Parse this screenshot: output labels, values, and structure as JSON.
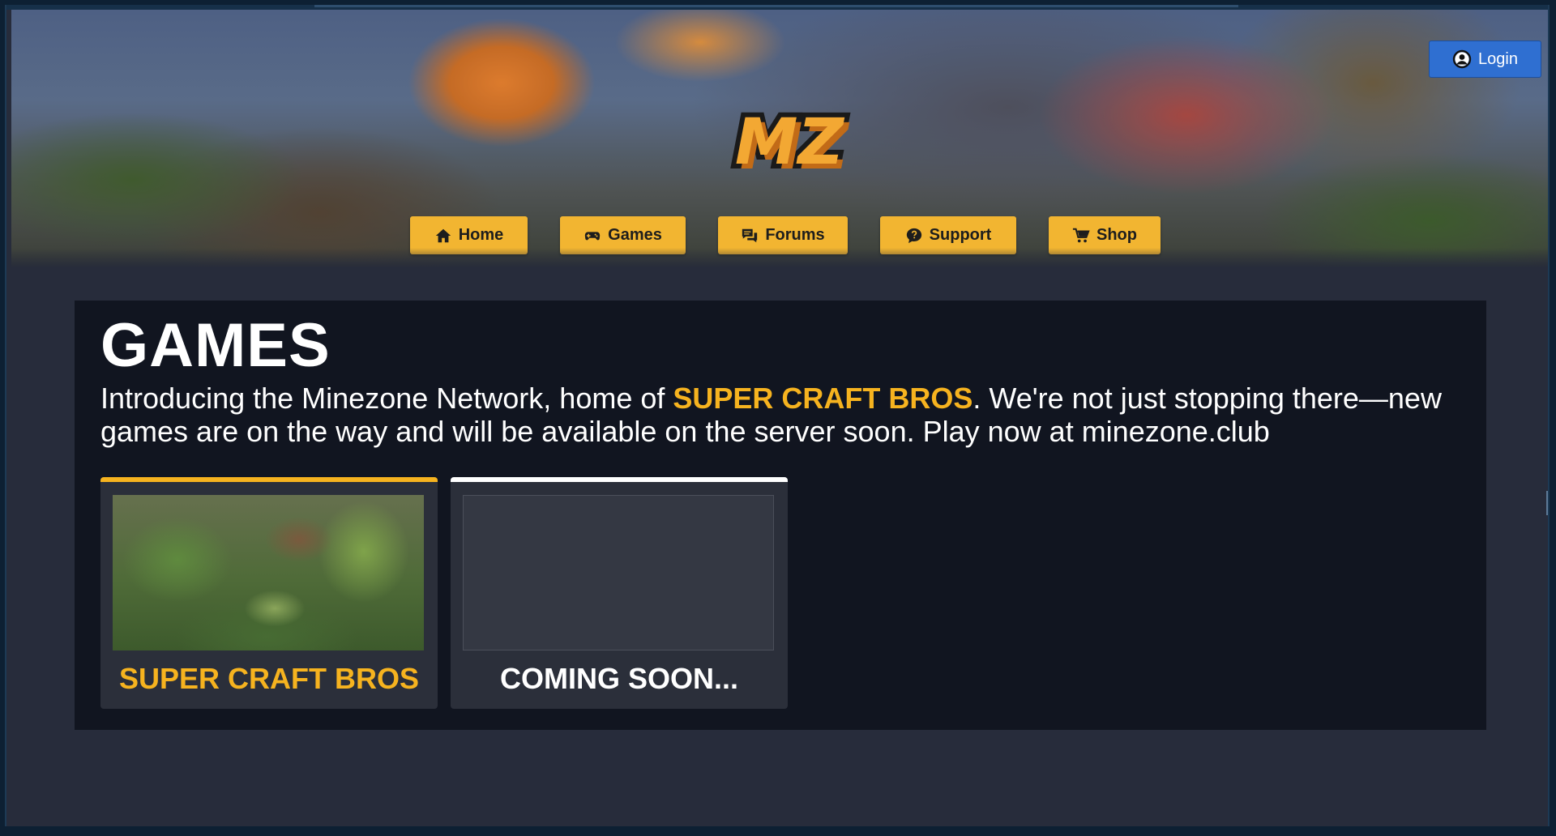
{
  "header": {
    "login_label": "Login",
    "logo_text": "MZ"
  },
  "nav": {
    "items": [
      {
        "label": "Home",
        "icon": "home-icon"
      },
      {
        "label": "Games",
        "icon": "gamepad-icon"
      },
      {
        "label": "Forums",
        "icon": "chat-icon"
      },
      {
        "label": "Support",
        "icon": "question-bubble-icon"
      },
      {
        "label": "Shop",
        "icon": "cart-icon"
      }
    ]
  },
  "main": {
    "title": "GAMES",
    "intro_prefix": "Introducing the Minezone Network, home of ",
    "intro_highlight": "SUPER CRAFT BROS",
    "intro_suffix": ". We're not just stopping there—new games are on the way and will be available on the server soon. Play now at minezone.club",
    "cards": [
      {
        "label": "SUPER CRAFT BROS",
        "accent": "#f6b31f"
      },
      {
        "label": "COMING SOON...",
        "accent": "#ffffff"
      }
    ]
  },
  "colors": {
    "accent": "#f5b52a",
    "login_blue": "#2c6fd6",
    "panel_bg": "#111520",
    "page_bg": "#272c3b"
  }
}
